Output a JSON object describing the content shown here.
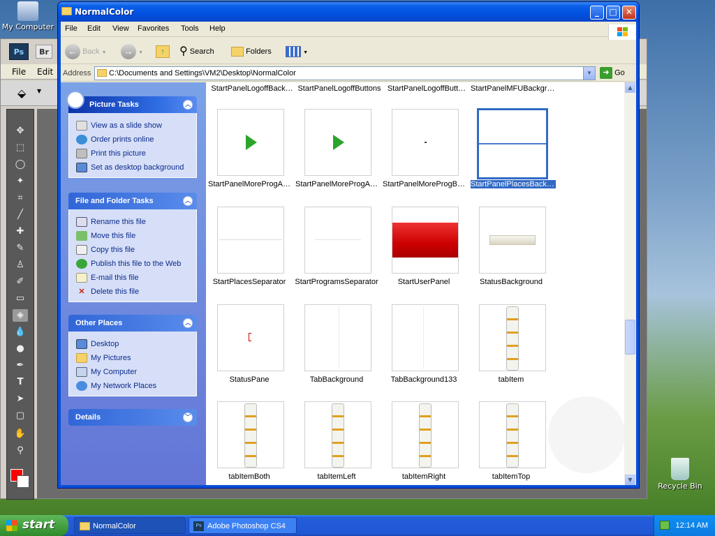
{
  "desktop": {
    "icons": [
      {
        "label": "My Computer"
      },
      {
        "label": "Recycle Bin"
      }
    ]
  },
  "photoshop": {
    "menu": [
      "File",
      "Edit"
    ],
    "badges": [
      "Ps",
      "Br"
    ]
  },
  "window": {
    "title": "NormalColor",
    "menu": [
      "File",
      "Edit",
      "View",
      "Favorites",
      "Tools",
      "Help"
    ],
    "toolbar": {
      "back": "Back",
      "search": "Search",
      "folders": "Folders"
    },
    "address": {
      "label": "Address",
      "value": "C:\\Documents and Settings\\VM2\\Desktop\\NormalColor",
      "go": "Go"
    }
  },
  "tasks": {
    "picture": {
      "title": "Picture Tasks",
      "items": [
        "View as a slide show",
        "Order prints online",
        "Print this picture",
        "Set as desktop background"
      ]
    },
    "file": {
      "title": "File and Folder Tasks",
      "items": [
        "Rename this file",
        "Move this file",
        "Copy this file",
        "Publish this file to the Web",
        "E-mail this file",
        "Delete this file"
      ]
    },
    "other": {
      "title": "Other Places",
      "items": [
        "Desktop",
        "My Pictures",
        "My Computer",
        "My Network Places"
      ]
    },
    "details": {
      "title": "Details"
    }
  },
  "files": [
    "StartPanelLogoffBack…",
    "StartPanelLogoffButtons",
    "StartPanelLogoffButt…",
    "StartPanelMFUBackgro…",
    "StartPanelMoreProgA…",
    "StartPanelMoreProgA…",
    "StartPanelMoreProgB…",
    "StartPanelPlacesBackground",
    "StartPlacesSeparator",
    "StartProgramsSeparator",
    "StartUserPanel",
    "StatusBackground",
    "StatusPane",
    "TabBackground",
    "TabBackground133",
    "tabItem",
    "tabItemBoth",
    "tabItemLeft",
    "tabItemRight",
    "tabItemTop"
  ],
  "taskbar": {
    "start": "start",
    "tasks": [
      "NormalColor",
      "Adobe Photoshop CS4"
    ],
    "clock": "12:14 AM"
  }
}
